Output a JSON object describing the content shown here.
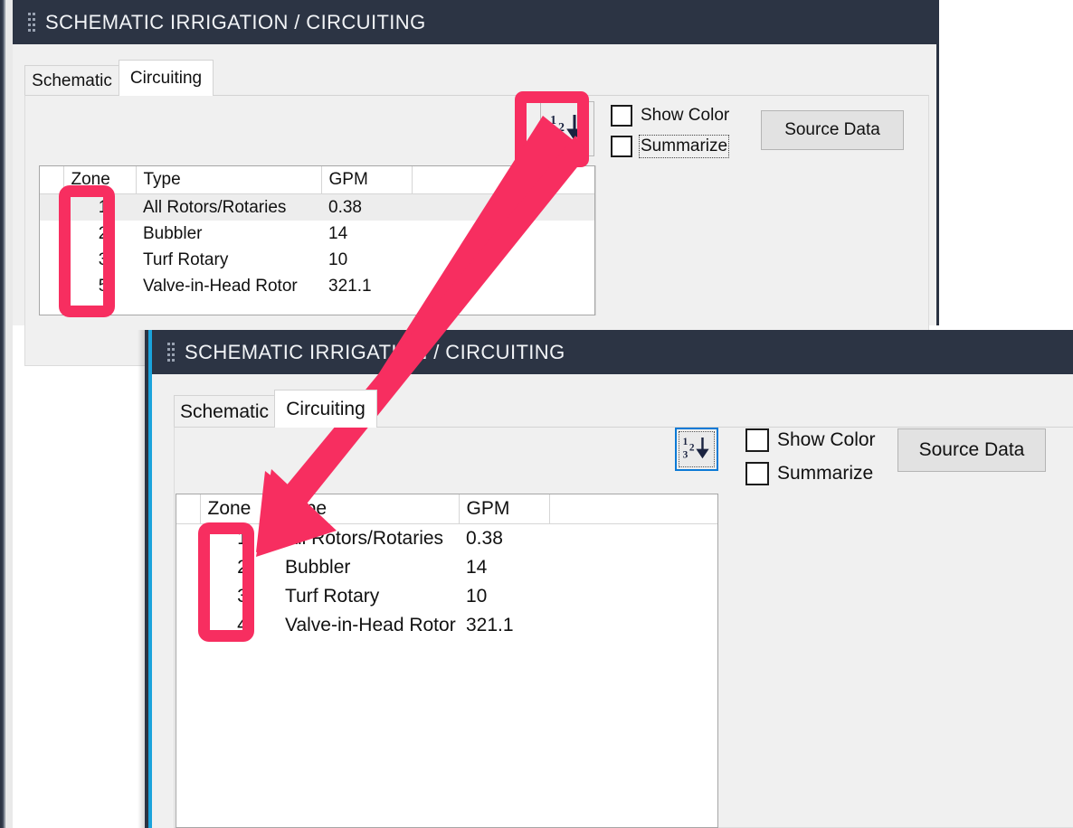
{
  "annotation": {
    "color": "#f72e60",
    "arrow": {
      "from_label": "sort-ascending-button",
      "to_label": "zone-column-values"
    },
    "highlights": [
      {
        "target": "sort-ascending-button",
        "window": "window-1"
      },
      {
        "target": "zone-column-values",
        "window": "window-1"
      },
      {
        "target": "zone-column-values",
        "window": "window-2"
      }
    ]
  },
  "windows": [
    {
      "id": "window-1",
      "title": "SCHEMATIC IRRIGATION / CIRCUITING",
      "accent_color": "#2c3444",
      "tabs": [
        {
          "label": "Schematic",
          "active": false
        },
        {
          "label": "Circuiting",
          "active": true
        }
      ],
      "toolbar": {
        "sort_button": {
          "icon": "sort-ascending-icon",
          "digits": [
            "1",
            "2",
            "3"
          ],
          "focused": false
        },
        "checkboxes": [
          {
            "label": "Show Color",
            "checked": false,
            "focused": false
          },
          {
            "label": "Summarize",
            "checked": false,
            "focused": true
          }
        ],
        "source_data_label": "Source Data"
      },
      "grid": {
        "columns": [
          "",
          "Zone",
          "Type",
          "GPM",
          ""
        ],
        "rows": [
          {
            "selected": true,
            "zone": "1",
            "type": "All Rotors/Rotaries",
            "gpm": "0.38"
          },
          {
            "selected": false,
            "zone": "2",
            "type": "Bubbler",
            "gpm": "14"
          },
          {
            "selected": false,
            "zone": "3",
            "type": "Turf Rotary",
            "gpm": "10"
          },
          {
            "selected": false,
            "zone": "5",
            "type": "Valve-in-Head Rotor",
            "gpm": "321.1"
          }
        ]
      }
    },
    {
      "id": "window-2",
      "title": "SCHEMATIC IRRIGATION / CIRCUITING",
      "accent_color": "#2c3444",
      "tabs": [
        {
          "label": "Schematic",
          "active": false
        },
        {
          "label": "Circuiting",
          "active": true
        }
      ],
      "toolbar": {
        "sort_button": {
          "icon": "sort-ascending-icon",
          "digits": [
            "1",
            "2",
            "3"
          ],
          "focused": true
        },
        "checkboxes": [
          {
            "label": "Show Color",
            "checked": false,
            "focused": false
          },
          {
            "label": "Summarize",
            "checked": false,
            "focused": false
          }
        ],
        "source_data_label": "Source Data"
      },
      "grid": {
        "columns": [
          "",
          "Zone",
          "Type",
          "GPM",
          ""
        ],
        "rows": [
          {
            "selected": false,
            "zone": "1",
            "type": "All Rotors/Rotaries",
            "gpm": "0.38"
          },
          {
            "selected": false,
            "zone": "2",
            "type": "Bubbler",
            "gpm": "14"
          },
          {
            "selected": false,
            "zone": "3",
            "type": "Turf Rotary",
            "gpm": "10"
          },
          {
            "selected": false,
            "zone": "4",
            "type": "Valve-in-Head Rotor",
            "gpm": "321.1"
          }
        ]
      }
    }
  ]
}
